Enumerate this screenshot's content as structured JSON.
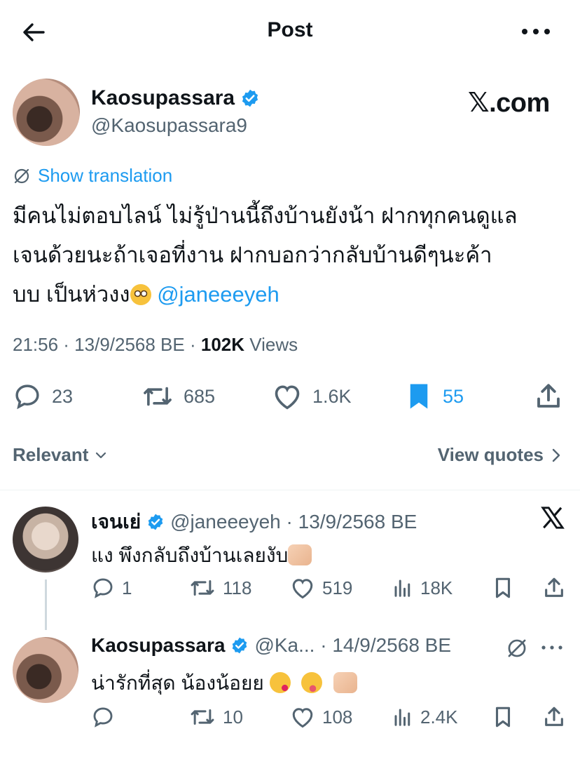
{
  "header": {
    "title": "Post"
  },
  "post": {
    "author_name": "Kaosupassara",
    "author_handle": "@Kaosupassara9",
    "watermark": "𝕏.com",
    "translate_label": "Show translation",
    "text_line1": "มีคนไม่ตอบไลน์ ไม่รู้ป่านนี้ถึงบ้านยังน้า ฝากทุกคนดูแล",
    "text_line2": "เจนด้วยนะถ้าเจอที่งาน ฝากบอกว่ากลับบ้านดีๆนะค้า",
    "text_line3": "บบ เป็นห่วงง",
    "mention": "@janeeeyeh",
    "time": "21:56 · 13/9/2568 BE · ",
    "views_count": "102K",
    "views_label": " Views",
    "replies": "23",
    "reposts": "685",
    "likes": "1.6K",
    "bookmarks": "55"
  },
  "sort": {
    "relevant_label": "Relevant",
    "view_quotes_label": "View quotes"
  },
  "replies": [
    {
      "name": "เจนเย่",
      "handle_date": "@janeeeyeh · 13/9/2568 BE",
      "text": "แง พึงกลับถึงบ้านเลยงับ",
      "replies": "1",
      "reposts": "118",
      "likes": "519",
      "views": "18K"
    },
    {
      "name": "Kaosupassara",
      "handle_date": "@Ka... · 14/9/2568 BE",
      "text": "น่ารักที่สุด น้องน้อยย",
      "replies": "",
      "reposts": "10",
      "likes": "108",
      "views": "2.4K"
    }
  ],
  "colors": {
    "accent": "#1d9bf0",
    "muted": "#536471",
    "text": "#0f1419"
  }
}
